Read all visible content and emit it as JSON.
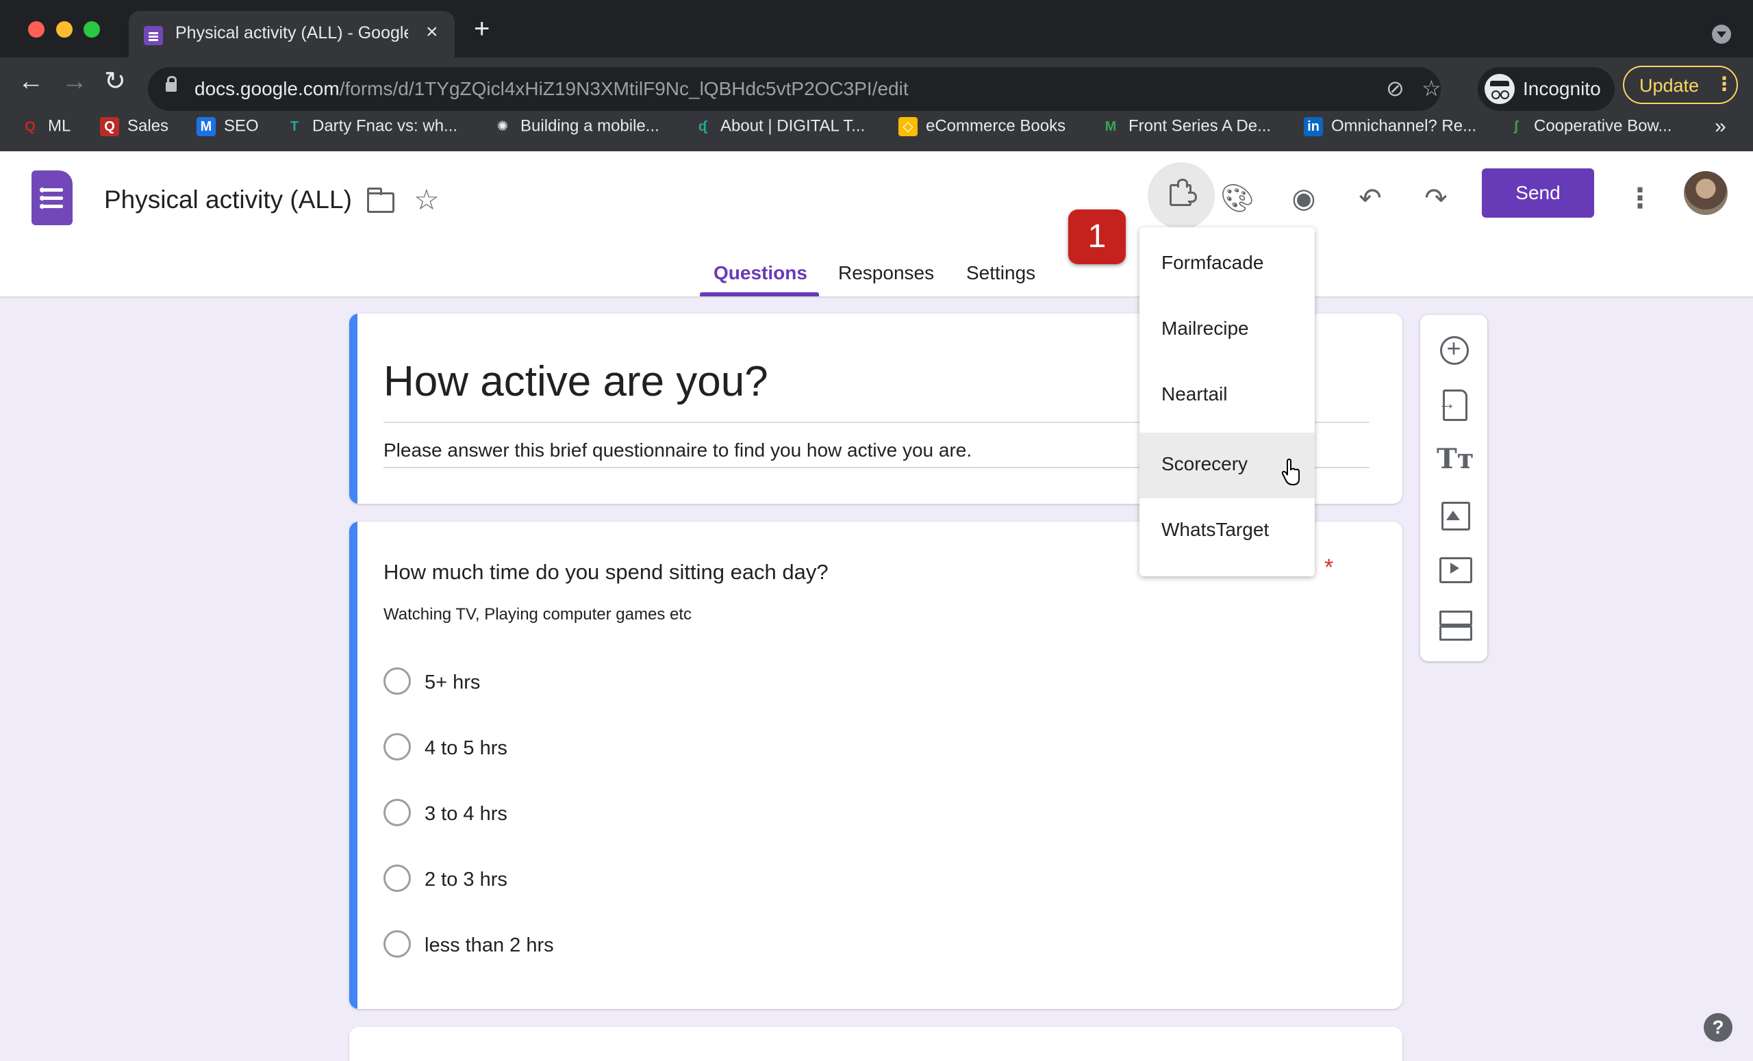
{
  "browser": {
    "tab_title": "Physical activity (ALL) - Google Forms",
    "new_tab": "+",
    "url_host": "docs.google.com",
    "url_path": "/forms/d/1TYgZQicl4xHiZ19N3XMtilF9Nc_lQBHdc5vtP2OC3PI/edit",
    "profile_label": "Incognito",
    "update_label": "Update",
    "bookmarks": [
      {
        "label": "ML",
        "icon": "quora-icon",
        "color": "#b92b27"
      },
      {
        "label": "Sales",
        "icon": "quora-icon",
        "color": "#b92b27"
      },
      {
        "label": "SEO",
        "icon": "email-icon",
        "color": "#1a73e8"
      },
      {
        "label": "Darty Fnac vs: wh...",
        "icon": "typography-icon",
        "color": "#26a69a"
      },
      {
        "label": "Building a mobile...",
        "icon": "openai-icon",
        "color": "#e8eaed"
      },
      {
        "label": "About | DIGITAL T...",
        "icon": "digital-icon",
        "color": "#26a69a"
      },
      {
        "label": "eCommerce Books",
        "icon": "book-icon",
        "color": "#fbbc04"
      },
      {
        "label": "Front Series A De...",
        "icon": "medium-icon",
        "color": "#34a853"
      },
      {
        "label": "Omnichannel? Re...",
        "icon": "linkedin-icon",
        "color": "#0a66c2"
      },
      {
        "label": "Cooperative Bow...",
        "icon": "leaf-icon",
        "color": "#34a853"
      }
    ],
    "more_bookmarks": "»"
  },
  "app": {
    "form_title": "Physical activity (ALL)",
    "send_label": "Send",
    "tabs": [
      {
        "label": "Questions",
        "active": true
      },
      {
        "label": "Responses",
        "active": false
      },
      {
        "label": "Settings",
        "active": false
      }
    ],
    "accent_color": "#673ab7"
  },
  "addon_menu": {
    "items": [
      "Formfacade",
      "Mailrecipe",
      "Neartail",
      "Scorecery",
      "WhatsTarget"
    ],
    "hovered": "Scorecery"
  },
  "badge": "1",
  "form": {
    "heading": "How active are you?",
    "description": "Please answer this brief questionnaire to find you how active you are.",
    "question": {
      "title": "How much time do you spend sitting each day?",
      "required_mark": "*",
      "description": "Watching TV, Playing computer games etc",
      "options": [
        "5+ hrs",
        "4 to 5 hrs",
        "3 to 4 hrs",
        "2 to 3 hrs",
        "less than 2 hrs"
      ]
    }
  },
  "side_toolbar": {
    "title_icon_glyph": "Tт"
  },
  "help": "?"
}
